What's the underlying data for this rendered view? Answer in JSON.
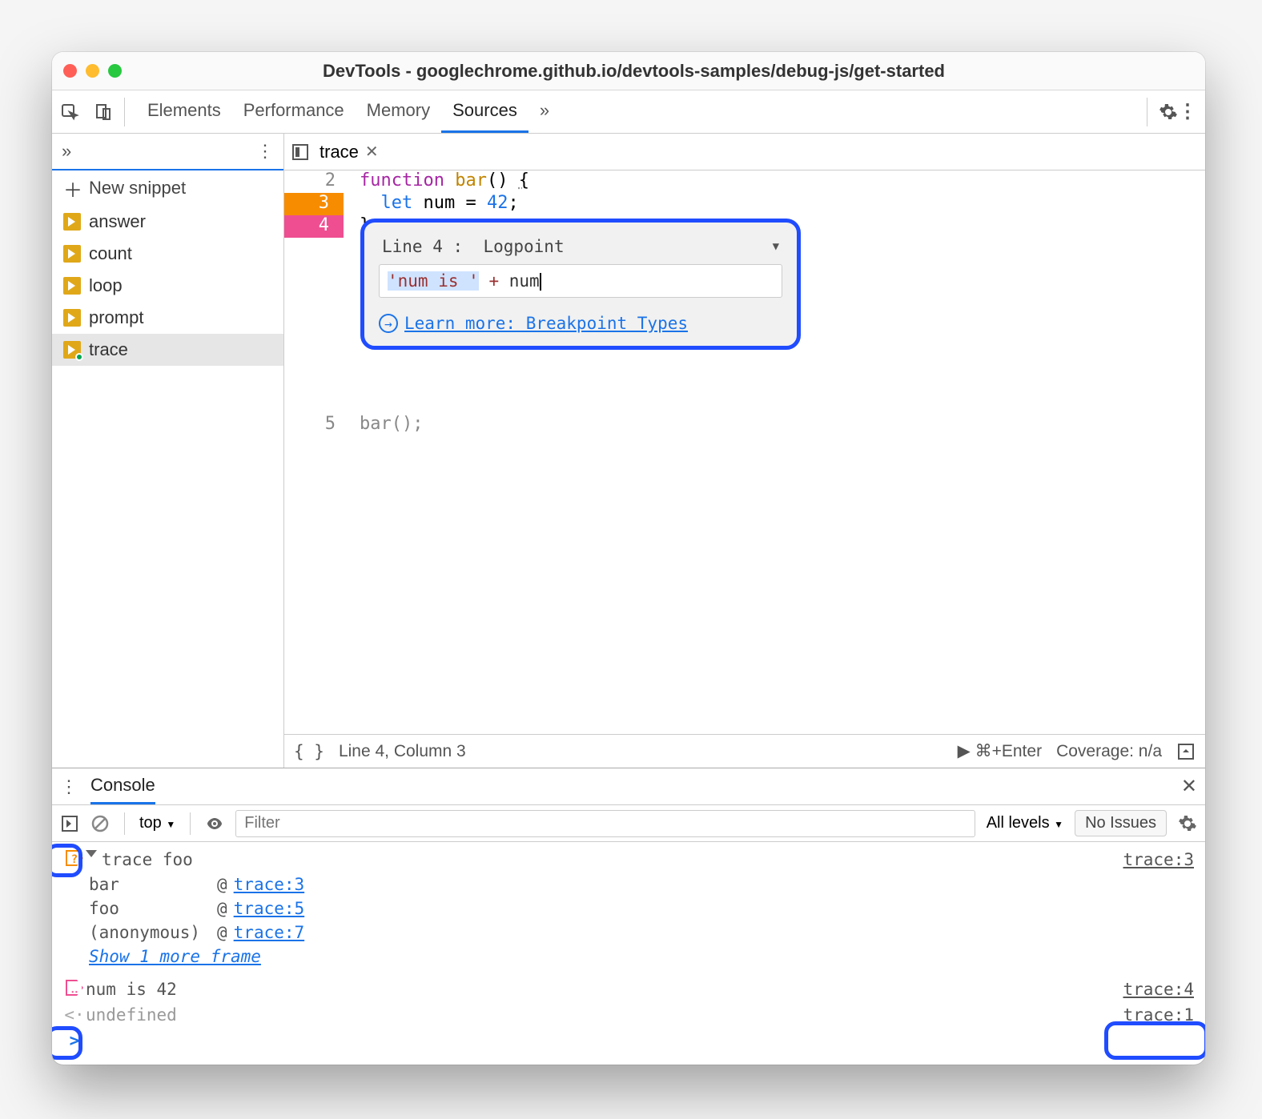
{
  "window": {
    "title": "DevTools - googlechrome.github.io/devtools-samples/debug-js/get-started"
  },
  "toolbar": {
    "tabs": [
      "Elements",
      "Performance",
      "Memory",
      "Sources"
    ],
    "active_tab": "Sources",
    "more_tabs": "»"
  },
  "sidebar": {
    "more": "»",
    "new_snippet": "New snippet",
    "items": [
      {
        "label": "answer"
      },
      {
        "label": "count"
      },
      {
        "label": "loop"
      },
      {
        "label": "prompt"
      },
      {
        "label": "trace",
        "active": true,
        "modified": true
      }
    ]
  },
  "editor": {
    "tab_name": "trace",
    "lines": {
      "l2_num": "2",
      "l2_code_pre": "function",
      "l2_code_fn": " bar",
      "l2_code_post": "() ",
      "l2_brace": "{",
      "l3_num": "3",
      "l3_let": "let",
      "l3_mid": " num = ",
      "l3_val": "42",
      "l3_end": ";",
      "l4_num": "4",
      "l4_brace": "}",
      "l5_num": "5",
      "l5_code": "bar();"
    },
    "popover": {
      "line_label": "Line 4 :",
      "type": "Logpoint",
      "input_quoted": "'num is '",
      "input_op": " + ",
      "input_var": "num",
      "learn_more": "Learn more: Breakpoint Types"
    },
    "status": {
      "position": "Line 4, Column 3",
      "run_hint": "⌘+Enter",
      "coverage": "Coverage: n/a"
    }
  },
  "console": {
    "tab": "Console",
    "context": "top",
    "filter_placeholder": "Filter",
    "levels": "All levels",
    "issues": "No Issues",
    "entries": [
      {
        "kind": "trace",
        "expand": true,
        "text": "trace foo",
        "source": "trace:3",
        "stack": [
          {
            "name": "bar",
            "at": "@",
            "link": "trace:3"
          },
          {
            "name": "foo",
            "at": "@",
            "link": "trace:5"
          },
          {
            "name": "(anonymous)",
            "at": "@",
            "link": "trace:7"
          }
        ],
        "show_more": "Show 1 more frame"
      },
      {
        "kind": "logpoint",
        "text": "num is 42",
        "source": "trace:4"
      },
      {
        "kind": "return",
        "text": "undefined",
        "source": "trace:1"
      }
    ]
  }
}
